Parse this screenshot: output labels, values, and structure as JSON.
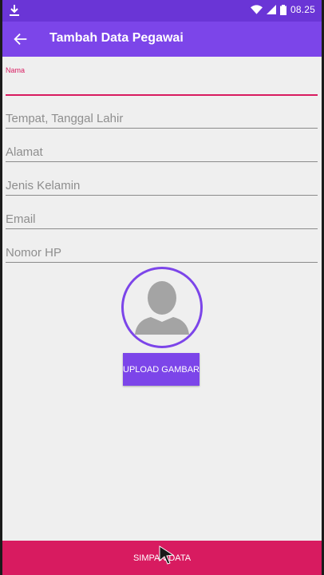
{
  "status_bar": {
    "time": "08.25",
    "icons": [
      "download-icon",
      "wifi-icon",
      "signal-icon",
      "battery-icon"
    ]
  },
  "toolbar": {
    "title": "Tambah Data Pegawai",
    "back_icon": "arrow-back-icon"
  },
  "form": {
    "fields": [
      {
        "label": "Nama",
        "placeholder": "",
        "value": ""
      },
      {
        "label": "",
        "placeholder": "Tempat, Tanggal Lahir",
        "value": ""
      },
      {
        "label": "",
        "placeholder": "Alamat",
        "value": ""
      },
      {
        "label": "",
        "placeholder": "Jenis Kelamin",
        "value": ""
      },
      {
        "label": "",
        "placeholder": "Email",
        "value": ""
      },
      {
        "label": "",
        "placeholder": "Nomor HP",
        "value": ""
      }
    ]
  },
  "avatar": {
    "icon": "person-avatar-icon"
  },
  "buttons": {
    "upload_label": "UPLOAD GAMBAR",
    "save_label": "SIMPAN DATA"
  },
  "colors": {
    "status_bar": "#6a35d6",
    "primary": "#7c45e9",
    "accent": "#d81b60",
    "background": "#efefef"
  }
}
